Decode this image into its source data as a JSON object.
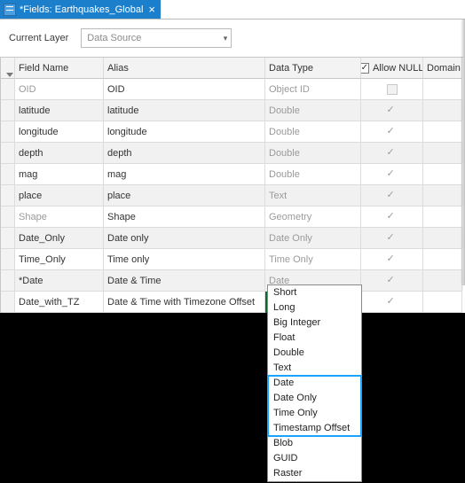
{
  "tab": {
    "title": "*Fields: Earthquakes_Global"
  },
  "toolbar": {
    "currentLayerLabel": "Current Layer",
    "dataSourceValue": "Data Source"
  },
  "columns": {
    "fieldName": "Field Name",
    "alias": "Alias",
    "dataType": "Data Type",
    "allowNull": "Allow NULL",
    "domain": "Domain",
    "nullHeaderCheck": "✓",
    "dropArrow": "▾"
  },
  "rows": [
    {
      "name": "OID",
      "alias": "OID",
      "type": "Object ID",
      "nameDim": true,
      "typeDim": true,
      "null": false
    },
    {
      "name": "latitude",
      "alias": "latitude",
      "type": "Double",
      "nameDim": false,
      "typeDim": true,
      "null": true
    },
    {
      "name": "longitude",
      "alias": "longitude",
      "type": "Double",
      "nameDim": false,
      "typeDim": true,
      "null": true
    },
    {
      "name": "depth",
      "alias": "depth",
      "type": "Double",
      "nameDim": false,
      "typeDim": true,
      "null": true
    },
    {
      "name": "mag",
      "alias": "mag",
      "type": "Double",
      "nameDim": false,
      "typeDim": true,
      "null": true
    },
    {
      "name": "place",
      "alias": "place",
      "type": "Text",
      "nameDim": false,
      "typeDim": true,
      "null": true
    },
    {
      "name": "Shape",
      "alias": "Shape",
      "type": "Geometry",
      "nameDim": true,
      "typeDim": true,
      "null": true
    },
    {
      "name": "Date_Only",
      "alias": "Date only",
      "type": "Date Only",
      "nameDim": false,
      "typeDim": true,
      "null": true
    },
    {
      "name": "Time_Only",
      "alias": "Time only",
      "type": "Time Only",
      "nameDim": false,
      "typeDim": true,
      "null": true
    },
    {
      "name": "*Date",
      "alias": "Date & Time",
      "type": "Date",
      "nameDim": false,
      "typeDim": true,
      "null": true
    },
    {
      "name": "Date_with_TZ",
      "alias": "Date & Time with Timezone Offset",
      "type": "Timestamp Offset",
      "nameDim": false,
      "typeDim": false,
      "null": true,
      "activeType": true
    }
  ],
  "check": "✓",
  "typeDropdown": {
    "items": [
      "Short",
      "Long",
      "Big Integer",
      "Float",
      "Double",
      "Text",
      "Date",
      "Date Only",
      "Time Only",
      "Timestamp Offset",
      "Blob",
      "GUID",
      "Raster"
    ]
  }
}
